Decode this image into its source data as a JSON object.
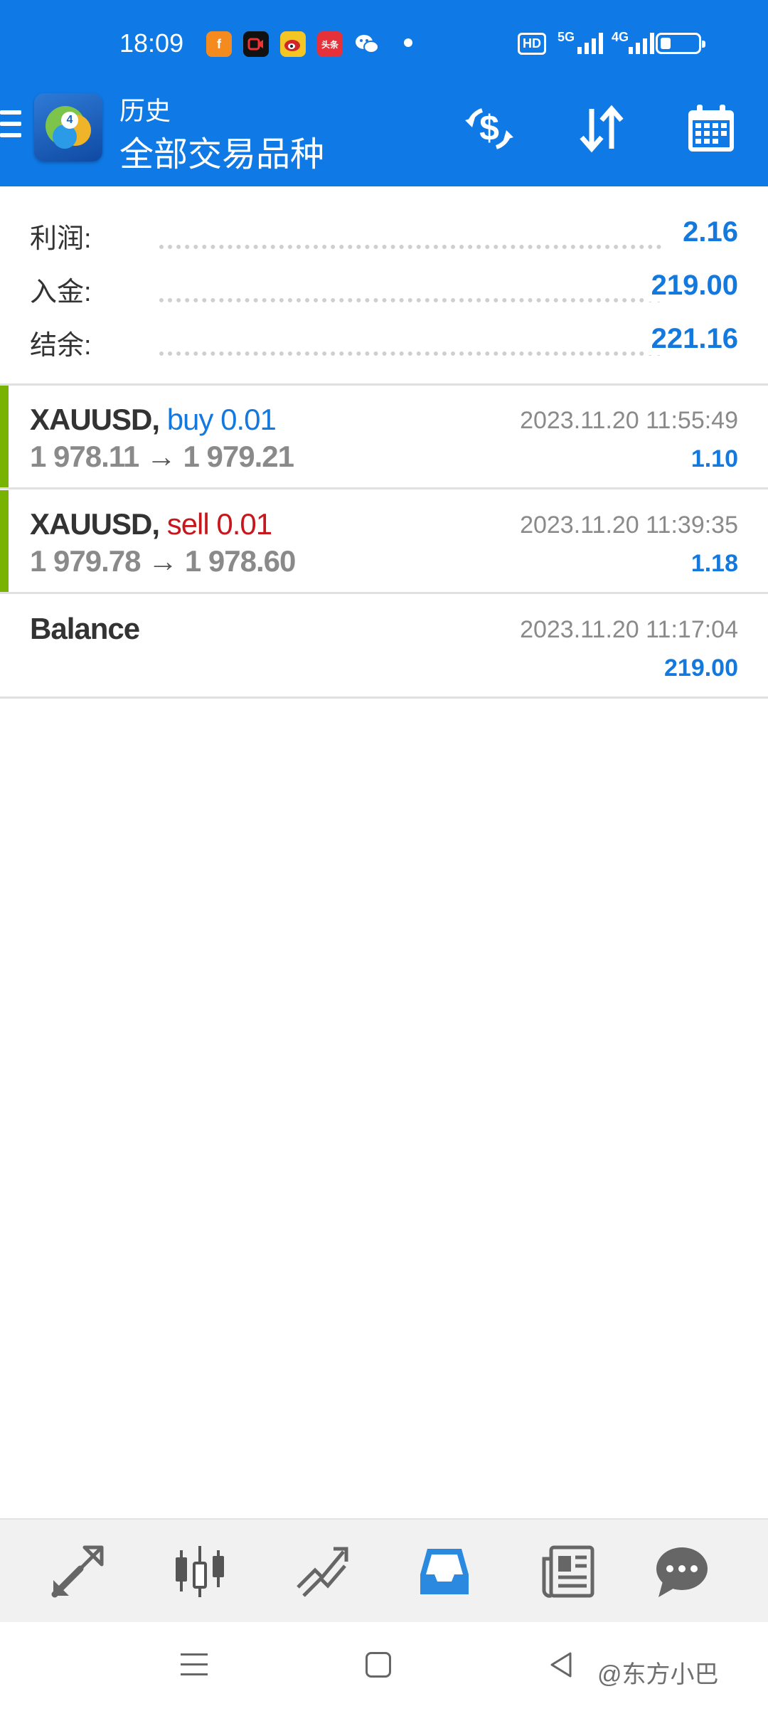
{
  "status_bar": {
    "time": "18:09",
    "notification_icons": [
      "fanfou-icon",
      "video-recorder-icon",
      "weibo-icon",
      "toutiao-icon",
      "wechat-icon"
    ],
    "toutiao_text": "头条",
    "network_hd": "HD",
    "network_5g": "5G",
    "network_4g": "4G"
  },
  "header": {
    "subtitle": "历史",
    "title": "全部交易品种",
    "actions": [
      "currency-exchange-icon",
      "sort-icon",
      "calendar-icon"
    ]
  },
  "summary": {
    "rows": [
      {
        "label": "利润:",
        "value": "2.16"
      },
      {
        "label": "入金:",
        "value": "219.00"
      },
      {
        "label": "结余:",
        "value": "221.16"
      }
    ]
  },
  "deals": [
    {
      "symbol": "XAUUSD,",
      "action": "buy 0.01",
      "open": "1 978.11",
      "arrow": "→",
      "close": "1 979.21",
      "time": "2023.11.20 11:55:49",
      "profit": "1.10"
    },
    {
      "symbol": "XAUUSD,",
      "action": "sell 0.01",
      "open": "1 979.78",
      "arrow": "→",
      "close": "1 978.60",
      "time": "2023.11.20 11:39:35",
      "profit": "1.18"
    },
    {
      "symbol": "Balance",
      "time": "2023.11.20 11:17:04",
      "profit": "219.00"
    }
  ],
  "bottom_nav": {
    "items": [
      "quotes-icon",
      "chart-icon",
      "trade-icon",
      "history-icon",
      "news-icon",
      "messages-icon"
    ],
    "active": "history-icon",
    "active_color": "#2b8ae0"
  },
  "watermark": "@东方小巴",
  "colors": {
    "header_blue": "#0f79e6",
    "value_blue": "#1479de",
    "sell_red": "#c8161d",
    "deal_marker_green": "#77b300"
  }
}
